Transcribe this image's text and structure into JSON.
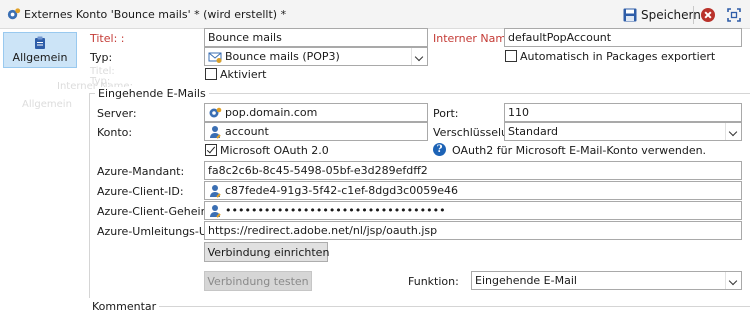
{
  "window": {
    "title": "Externes Konto 'Bounce mails' * (wird erstellt) *",
    "save_label": "Speichern"
  },
  "sidebar": {
    "items": [
      {
        "label": "Allgemein",
        "icon": "clipboard-icon",
        "selected": true
      }
    ]
  },
  "background_ghost": [
    "Titel:",
    "Typ:",
    "Interner Name:",
    "Allgemein"
  ],
  "general": {
    "title_label": "Titel: :",
    "title_value": "Bounce mails",
    "internal_name_label": "Interner Name:",
    "internal_name_value": "defaultPopAccount",
    "type_label": "Typ:",
    "type_value": "Bounce mails (POP3)",
    "export_checkbox_label": "Automatisch in Packages exportiert",
    "export_checked": false,
    "active_label": "Aktiviert",
    "active_checked": false
  },
  "incoming": {
    "group_title": "Eingehende E-Mails",
    "server_label": "Server:",
    "server_value": "pop.domain.com",
    "port_label": "Port:",
    "port_value": "110",
    "account_label": "Konto:",
    "account_value": "account",
    "encryption_label": "Verschlüsselung:",
    "encryption_value": "Standard",
    "oauth_label": "Microsoft OAuth 2.0",
    "oauth_checked": true,
    "oauth_info": "OAuth2 für Microsoft E-Mail-Konto verwenden.",
    "tenant_label": "Azure-Mandant:",
    "tenant_value": "fa8c2c6b-8c45-5498-05bf-e3d289efdff2",
    "client_id_label": "Azure-Client-ID:",
    "client_id_value": "c87fede4-91g3-5f42-c1ef-8dgd3c0059e46",
    "client_secret_label": "Azure-Client-Geheimnis:",
    "client_secret_value": "••••••••••••••••••••••••••••••••••",
    "redirect_label": "Azure-Umleitungs-URL:",
    "redirect_value": "https://redirect.adobe.net/nl/jsp/oauth.jsp",
    "connect_button": "Verbindung einrichten",
    "test_button": "Verbindung testen",
    "function_label": "Funktion:",
    "function_value": "Eingehende E-Mail"
  },
  "comment_label": "Kommentar",
  "colors": {
    "accent": "#1d63b6",
    "required_label": "#c43b36",
    "selected_tab": "#cce4f7"
  }
}
